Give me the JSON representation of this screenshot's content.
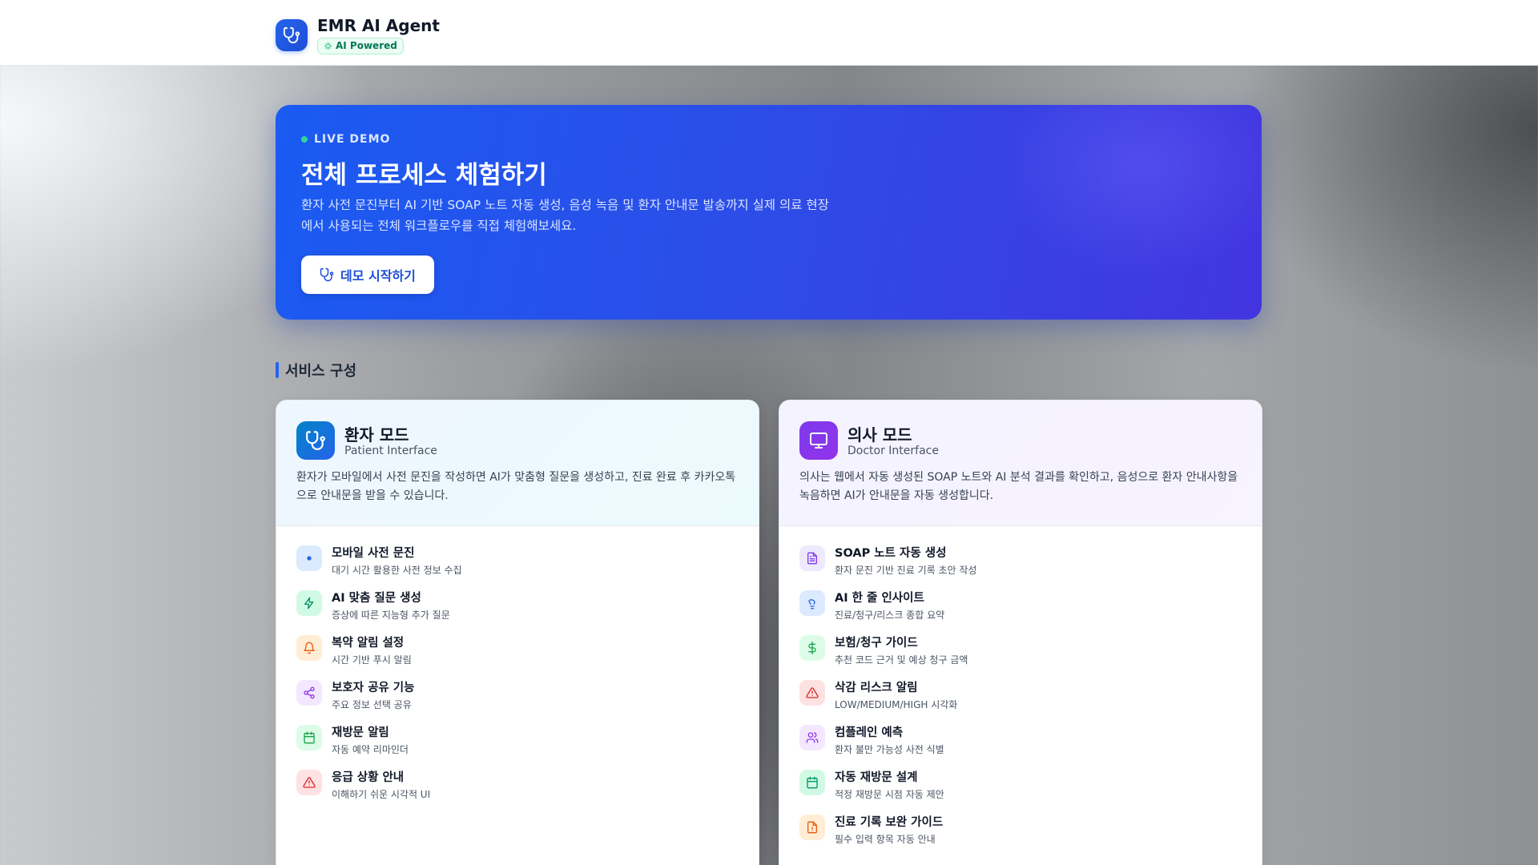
{
  "header": {
    "app_title": "EMR AI Agent",
    "badge": "AI Powered"
  },
  "hero": {
    "tag": "LIVE DEMO",
    "title": "전체 프로세스 체험하기",
    "description": "환자 사전 문진부터 AI 기반 SOAP 노트 자동 생성, 음성 녹음 및 환자 안내문 발송까지 실제 의료 현장에서 사용되는 전체 워크플로우를 직접 체험해보세요.",
    "button_label": "데모 시작하기"
  },
  "section": {
    "title": "서비스 구성"
  },
  "patient_mode": {
    "title": "환자 모드",
    "subtitle": "Patient Interface",
    "description": "환자가 모바일에서 사전 문진을 작성하면 AI가 맞춤형 질문을 생성하고, 진료 완료 후 카카오톡으로 안내문을 받을 수 있습니다.",
    "features": [
      {
        "title": "모바일 사전 문진",
        "subtitle": "대기 시간 활용한 사전 정보 수집",
        "icon": "dot-icon",
        "color": "#2563eb",
        "bg": "#dbeafe"
      },
      {
        "title": "AI 맞춤 질문 생성",
        "subtitle": "증상에 따른 지능형 추가 질문",
        "icon": "lightning-icon",
        "color": "#059669",
        "bg": "#d1fae5"
      },
      {
        "title": "복약 알림 설정",
        "subtitle": "시간 기반 푸시 알림",
        "icon": "bell-icon",
        "color": "#ea580c",
        "bg": "#ffedd5"
      },
      {
        "title": "보호자 공유 기능",
        "subtitle": "주요 정보 선택 공유",
        "icon": "share-icon",
        "color": "#9333ea",
        "bg": "#f3e8ff"
      },
      {
        "title": "재방문 알림",
        "subtitle": "자동 예약 리마인더",
        "icon": "calendar-icon",
        "color": "#16a34a",
        "bg": "#dcfce7"
      },
      {
        "title": "응급 상황 안내",
        "subtitle": "이해하기 쉬운 시각적 UI",
        "icon": "warning-icon",
        "color": "#dc2626",
        "bg": "#fee2e2"
      }
    ]
  },
  "doctor_mode": {
    "title": "의사 모드",
    "subtitle": "Doctor Interface",
    "description": "의사는 웹에서 자동 생성된 SOAP 노트와 AI 분석 결과를 확인하고, 음성으로 환자 안내사항을 녹음하면 AI가 안내문을 자동 생성합니다.",
    "features": [
      {
        "title": "SOAP 노트 자동 생성",
        "subtitle": "환자 문진 기반 진료 기록 초안 작성",
        "icon": "document-icon",
        "color": "#7c3aed",
        "bg": "#ede9fe"
      },
      {
        "title": "AI 한 줄 인사이트",
        "subtitle": "진료/청구/리스크 종합 요약",
        "icon": "lightbulb-icon",
        "color": "#2563eb",
        "bg": "#dbeafe"
      },
      {
        "title": "보험/청구 가이드",
        "subtitle": "추천 코드 근거 및 예상 청구 금액",
        "icon": "dollar-icon",
        "color": "#16a34a",
        "bg": "#dcfce7"
      },
      {
        "title": "삭감 리스크 알림",
        "subtitle": "LOW/MEDIUM/HIGH 시각화",
        "icon": "warning-icon",
        "color": "#dc2626",
        "bg": "#fee2e2"
      },
      {
        "title": "컴플레인 예측",
        "subtitle": "환자 불만 가능성 사전 식별",
        "icon": "users-icon",
        "color": "#9333ea",
        "bg": "#f3e8ff"
      },
      {
        "title": "자동 재방문 설계",
        "subtitle": "적정 재방문 시점 자동 제안",
        "icon": "calendar-icon",
        "color": "#059669",
        "bg": "#d1fae5"
      },
      {
        "title": "진료 기록 보완 가이드",
        "subtitle": "필수 입력 항목 자동 안내",
        "icon": "file-alert-icon",
        "color": "#ea580c",
        "bg": "#ffedd5"
      }
    ]
  }
}
